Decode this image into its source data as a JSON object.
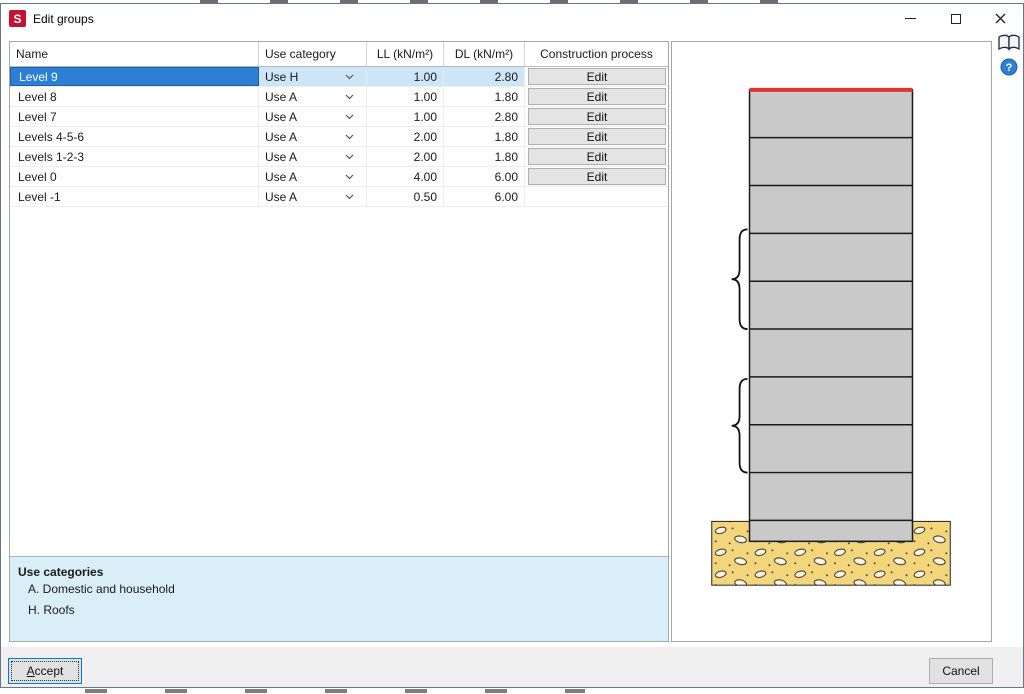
{
  "window": {
    "title": "Edit groups"
  },
  "table": {
    "headers": [
      "Name",
      "Use category",
      "LL (kN/m²)",
      "DL (kN/m²)",
      "Construction process"
    ],
    "rows": [
      {
        "name": "Level 9",
        "use_category": "Use H",
        "ll": "1.00",
        "dl": "2.80",
        "construction": "Edit",
        "selected": true
      },
      {
        "name": "Level 8",
        "use_category": "Use A",
        "ll": "1.00",
        "dl": "1.80",
        "construction": "Edit"
      },
      {
        "name": "Level 7",
        "use_category": "Use A",
        "ll": "1.00",
        "dl": "2.80",
        "construction": "Edit"
      },
      {
        "name": "Levels 4-5-6",
        "use_category": "Use A",
        "ll": "2.00",
        "dl": "1.80",
        "construction": "Edit"
      },
      {
        "name": "Levels 1-2-3",
        "use_category": "Use A",
        "ll": "2.00",
        "dl": "1.80",
        "construction": "Edit"
      },
      {
        "name": "Level 0",
        "use_category": "Use A",
        "ll": "4.00",
        "dl": "6.00",
        "construction": "Edit"
      },
      {
        "name": "Level -1",
        "use_category": "Use A",
        "ll": "0.50",
        "dl": "6.00"
      }
    ]
  },
  "info": {
    "title": "Use categories",
    "items": [
      "A. Domestic and household",
      "H. Roofs"
    ]
  },
  "footer": {
    "accept": "Accept",
    "cancel": "Cancel"
  },
  "icons": {
    "help": "?",
    "app_letter": "S"
  },
  "diagram": {
    "floors_above_ground": 9,
    "brace_groups": 2,
    "building_color": "#c9c9c9",
    "roof_line_color": "#e03333",
    "soil_color": "#f3d67c",
    "selection_color": "#2d7fd6",
    "info_panel_color": "#d9eef7"
  }
}
